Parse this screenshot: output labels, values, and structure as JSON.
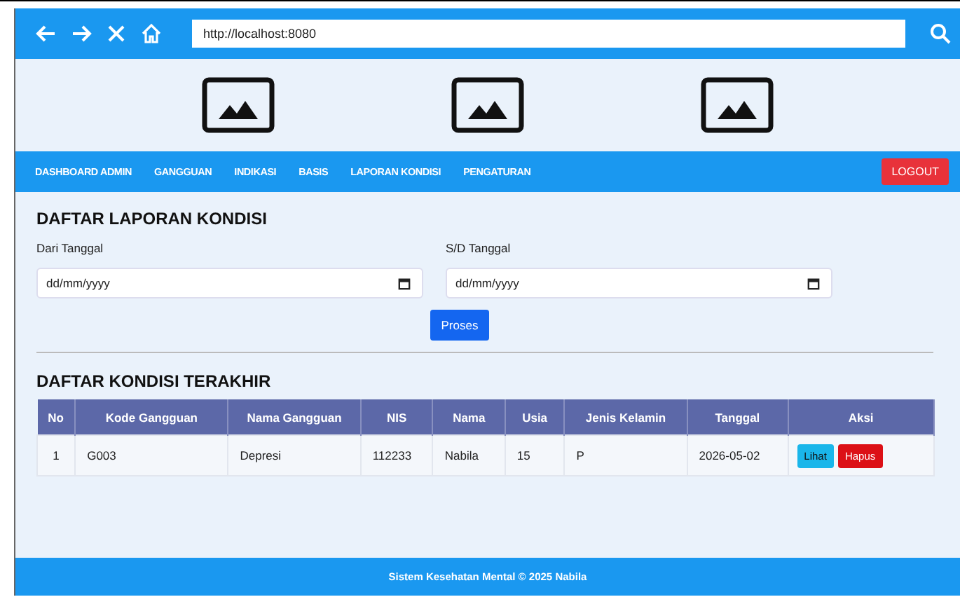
{
  "browser": {
    "url": "http://localhost:8080"
  },
  "nav": {
    "items": [
      {
        "label": "DASHBOARD ADMIN",
        "selected": false
      },
      {
        "label": "GANGGUAN",
        "selected": false
      },
      {
        "label": "INDIKASI",
        "selected": false
      },
      {
        "label": "BASIS",
        "selected": false
      },
      {
        "label": "LAPORAN KONDISI",
        "selected": false
      },
      {
        "label": "PENGATURAN",
        "selected": false
      }
    ],
    "logout": "LOGOUT"
  },
  "filter": {
    "title": "DAFTAR LAPORAN KONDISI",
    "fields": [
      {
        "label": "Dari Tanggal",
        "placeholder": "dd/mm/yyyy"
      },
      {
        "label": "S/D Tanggal",
        "placeholder": "dd/mm/yyyy"
      }
    ],
    "button": "Proses"
  },
  "table": {
    "title": "DAFTAR KONDISI TERAKHIR",
    "columns": [
      "No",
      "Kode Gangguan",
      "Nama Gangguan",
      "NIS",
      "Nama",
      "Usia",
      "Jenis Kelamin",
      "Tanggal",
      "Aksi"
    ],
    "rows": [
      {
        "cells": [
          "1",
          "G003",
          "Depresi",
          "112233",
          "Nabila",
          "15",
          "P",
          "2026-05-02"
        ],
        "actions": [
          "Lihat",
          "Hapus"
        ]
      }
    ]
  },
  "footer": "Sistem Kesehatan Mental © 2025 Nabila"
}
